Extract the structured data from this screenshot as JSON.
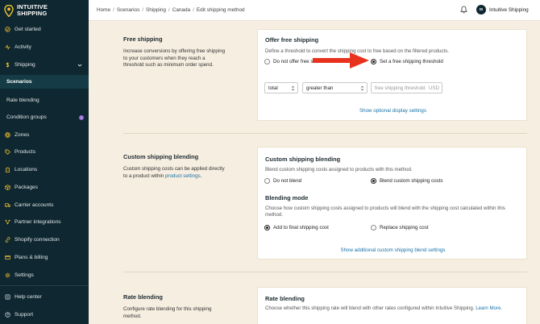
{
  "brand": {
    "line1": "INTUITIVE",
    "line2": "SHIPPING"
  },
  "sidebar": {
    "items": [
      {
        "label": "Get started",
        "icon": "check-circle-icon"
      },
      {
        "label": "Activity",
        "icon": "pulse-icon"
      },
      {
        "label": "Shipping",
        "icon": "dollar-icon"
      },
      {
        "label": "Scenarios",
        "icon": ""
      },
      {
        "label": "Rate blending",
        "icon": ""
      },
      {
        "label": "Condition groups",
        "icon": ""
      },
      {
        "label": "Zones",
        "icon": "globe-icon"
      },
      {
        "label": "Products",
        "icon": "tag-icon"
      },
      {
        "label": "Locations",
        "icon": "building-icon"
      },
      {
        "label": "Packages",
        "icon": "box-icon"
      },
      {
        "label": "Carrier accounts",
        "icon": "truck-icon"
      },
      {
        "label": "Partner integrations",
        "icon": "nodes-icon"
      },
      {
        "label": "Shopify connection",
        "icon": "link-icon"
      },
      {
        "label": "Plans & billing",
        "icon": "card-icon"
      },
      {
        "label": "Settings",
        "icon": "gear-icon"
      },
      {
        "label": "Help center",
        "icon": "help-icon"
      },
      {
        "label": "Support",
        "icon": "question-icon"
      }
    ],
    "badge": "1"
  },
  "breadcrumb": [
    "Home",
    "Scenarios",
    "Shipping",
    "Canada",
    "Edit shipping method"
  ],
  "user": {
    "initials": "IS",
    "name": "Intuitive Shipping"
  },
  "sections": {
    "free": {
      "left_title": "Free shipping",
      "left_desc": "Increase conversions by offering free shipping to your customers when they reach a threshold such as minimum order spend.",
      "card_title": "Offer free shipping",
      "card_text": "Define a threshold to convert the shipping cost to free based on the filtered products.",
      "opt_no": "Do not offer free s",
      "opt_yes": "Set a free shipping threshold",
      "select1": "total",
      "select2": "greater than",
      "input_placeholder": "free shipping threshold",
      "input_unit": "USD",
      "link": "Show optional display settings"
    },
    "custom": {
      "left_title": "Custom shipping blending",
      "left_desc_pre": "Custom shipping costs can be applied directly to a product within ",
      "left_link": "product settings",
      "left_desc_post": ".",
      "card_title": "Custom shipping blending",
      "card_text": "Blend custom shipping costs assigned to products with this method.",
      "opt_no": "Do not blend",
      "opt_yes": "Blend custom shipping costs",
      "mode_title": "Blending mode",
      "mode_text": "Choose how custom shipping costs assigned to products will blend with the shipping cost calculated within this method.",
      "mode_add": "Add to final shipping cost",
      "mode_replace": "Replace shipping cost",
      "link": "Show additional custom shipping blend settings"
    },
    "rate": {
      "left_title": "Rate blending",
      "left_desc": "Configure rate blending for this shipping method.",
      "card_title": "Rate blending",
      "card_text": "Choose whether this shipping rate will blend with other rates configured within Intuitive Shipping.",
      "learn_more": "Learn More."
    }
  },
  "colors": {
    "sidebar_bg": "#0f2730",
    "page_bg": "#f6eee0",
    "link": "#1a73a8",
    "arrow": "#e8321e",
    "logo": "#f2c230"
  }
}
